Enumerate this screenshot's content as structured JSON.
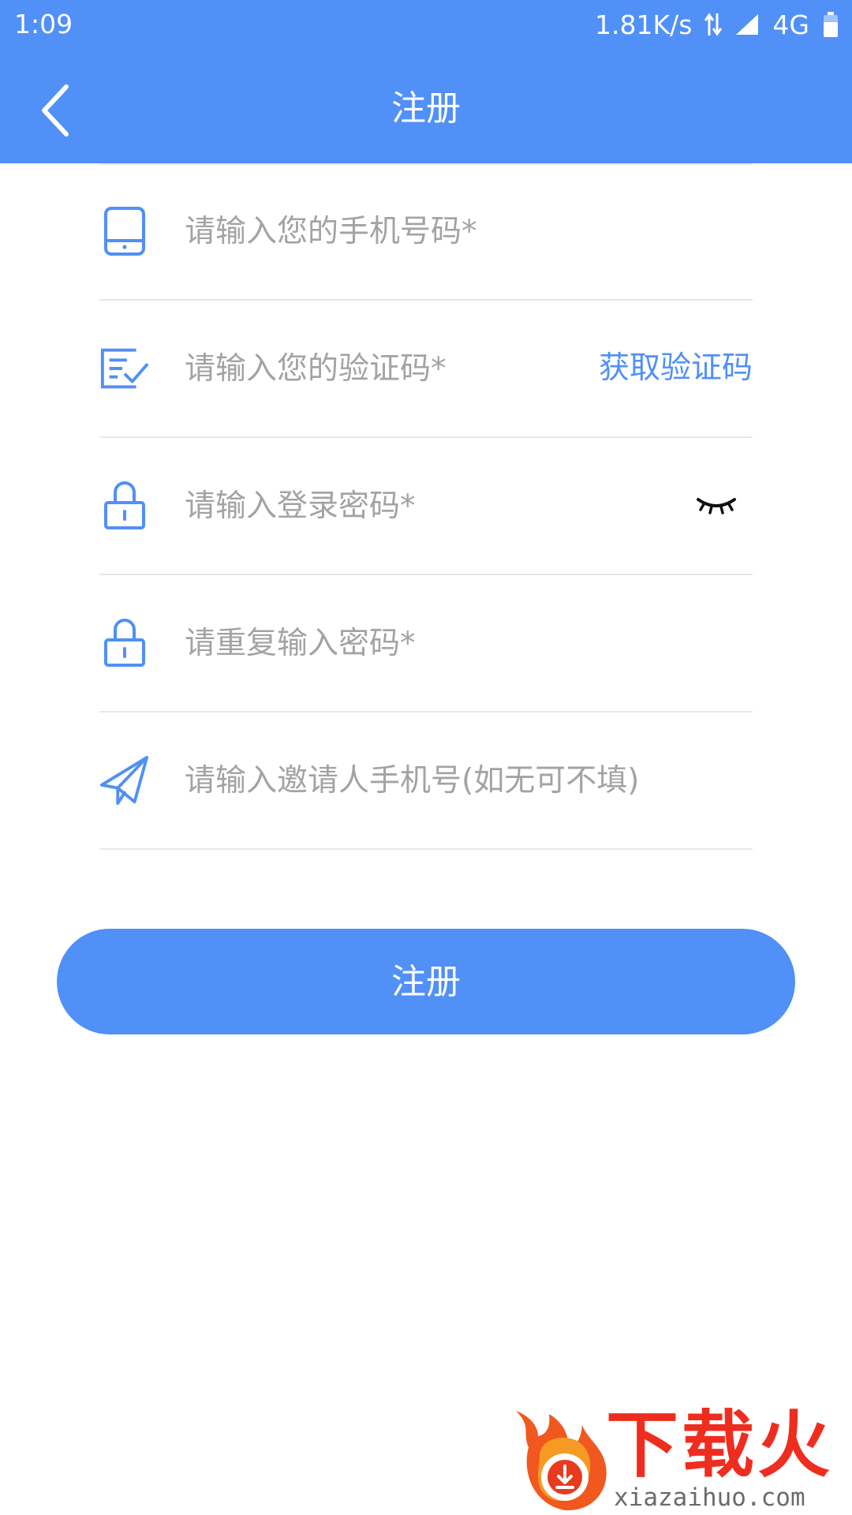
{
  "status_bar": {
    "time": "1:09",
    "net_speed": "1.81K/s",
    "network": "4G"
  },
  "header": {
    "title": "注册"
  },
  "form": {
    "phone": {
      "placeholder": "请输入您的手机号码*",
      "icon": "tablet-icon"
    },
    "code": {
      "placeholder": "请输入您的验证码*",
      "icon": "checklist-icon",
      "get_code_label": "获取验证码"
    },
    "password": {
      "placeholder": "请输入登录密码*",
      "icon": "lock-icon",
      "toggle_icon": "eye-closed-icon"
    },
    "confirm_password": {
      "placeholder": "请重复输入密码*",
      "icon": "lock-icon"
    },
    "inviter": {
      "placeholder": "请输入邀请人手机号(如无可不填)",
      "icon": "paper-plane-icon"
    }
  },
  "register_button": {
    "label": "注册"
  },
  "watermark": {
    "name": "下载火",
    "url": "xiazaihuo.com"
  },
  "colors": {
    "primary": "#5090f7",
    "placeholder": "#a3a3a3",
    "divider": "#e8e8e8",
    "watermark_red": "#ef2d1f"
  }
}
